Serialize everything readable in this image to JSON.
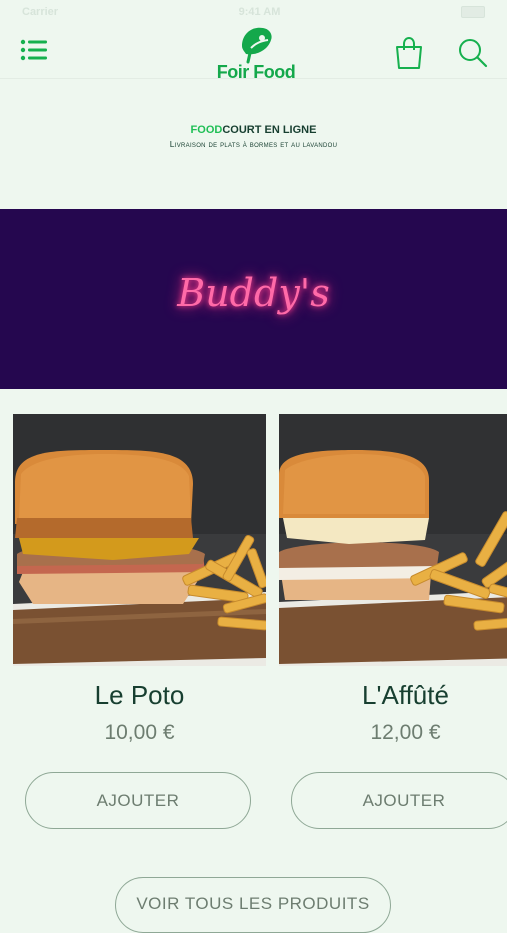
{
  "status": {
    "carrier": "Carrier",
    "time": "9:41 AM"
  },
  "header": {
    "logo_text": "Foir Food",
    "icons": {
      "menu": "menu-icon",
      "bag": "shopping-bag-icon",
      "search": "search-icon"
    },
    "accent_color": "#14a84b"
  },
  "tagline": {
    "title_highlight": "FOOD",
    "title_rest": "COURT EN LIGNE",
    "subtitle": "Livraison de plats à bormes et au lavandou"
  },
  "banner": {
    "text": "Buddy's",
    "bg_color": "#25074f",
    "text_color": "#ff6aa8"
  },
  "products": [
    {
      "name": "Le Poto",
      "price": "10,00 €",
      "button": "AJOUTER"
    },
    {
      "name": "L'Affûté",
      "price": "12,00 €",
      "button": "AJOUTER"
    }
  ],
  "view_all_label": "VOIR TOUS LES PRODUITS"
}
